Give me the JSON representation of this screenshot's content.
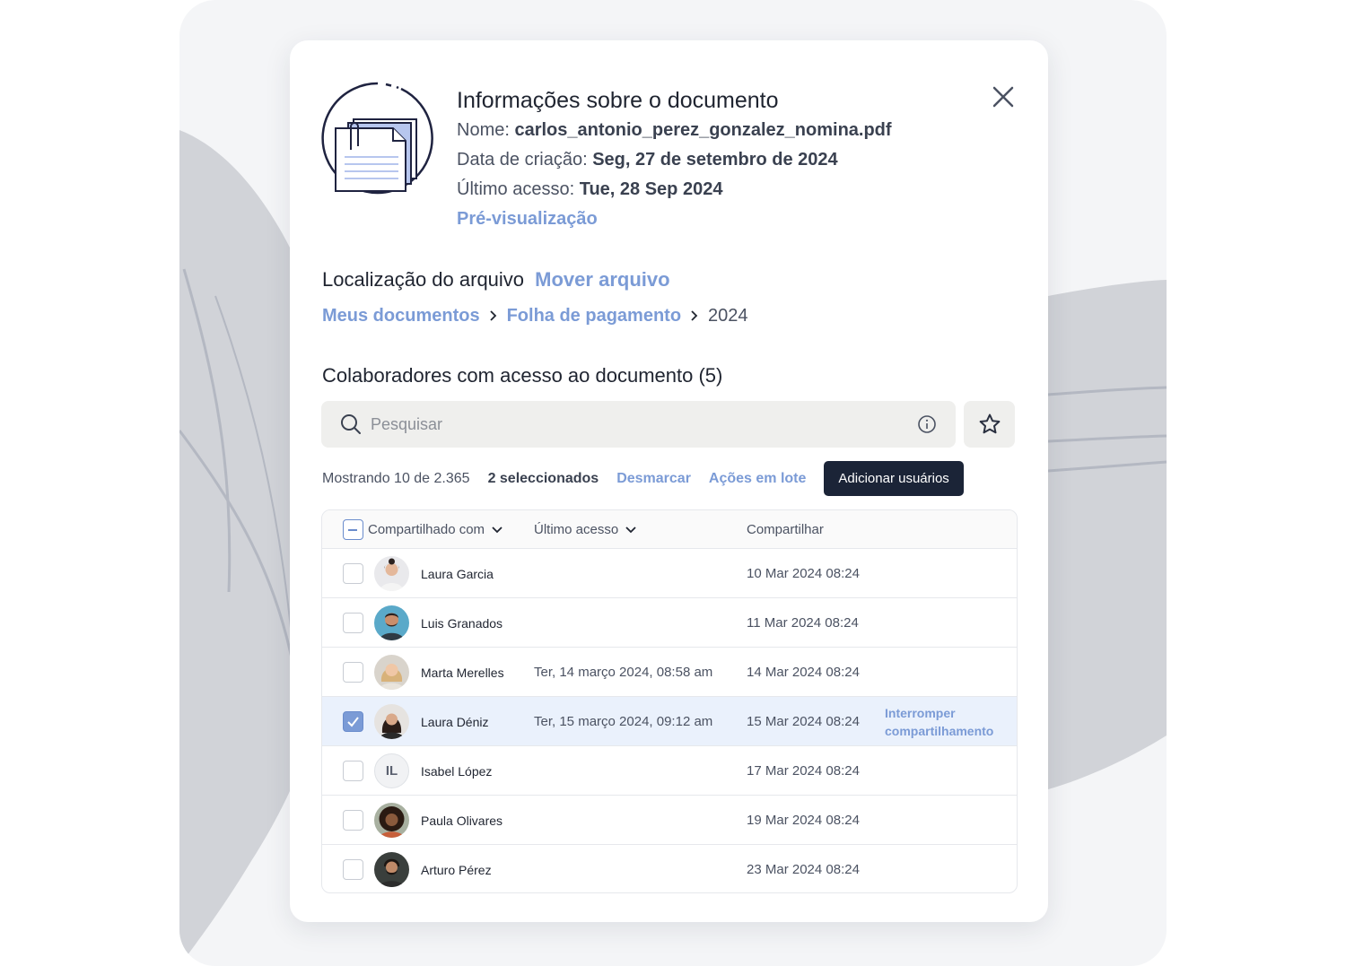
{
  "colors": {
    "accent": "#7b9bd6",
    "primary_button": "#1b2437",
    "selected_row": "#eaf1fc",
    "backdrop": "#f4f5f7"
  },
  "modal": {
    "title": "Informações sobre o documento",
    "name_label": "Nome:",
    "name_value": "carlos_antonio_perez_gonzalez_nomina.pdf",
    "created_label": "Data de criação:",
    "created_value": "Seg, 27 de setembro de 2024",
    "access_label": "Último acesso:",
    "access_value": "Tue, 28 Sep 2024",
    "preview_link": "Pré-visualização",
    "doc_icon": "document-stack-icon",
    "close_icon": "close-icon"
  },
  "location": {
    "title": "Localização do arquivo",
    "move_link": "Mover arquivo",
    "breadcrumb": [
      "Meus documentos",
      "Folha de pagamento",
      "2024"
    ]
  },
  "collaborators": {
    "title": "Colaboradores com acesso ao documento (5)",
    "search_placeholder": "Pesquisar",
    "showing": "Mostrando 10 de 2.365",
    "selected": "2 seleccionados",
    "deselect": "Desmarcar",
    "bulk_actions": "Ações em lote",
    "add_users": "Adicionar usuários",
    "columns": [
      "Compartilhado com",
      "Último acesso",
      "Compartilhar"
    ],
    "rows": [
      {
        "name": "Laura Garcia",
        "last_access": "",
        "shared": "10 Mar 2024 08:24",
        "checked": false
      },
      {
        "name": "Luis Granados",
        "last_access": "",
        "shared": "11 Mar 2024 08:24",
        "checked": false
      },
      {
        "name": "Marta Merelles",
        "last_access": "Ter, 14 março 2024, 08:58 am",
        "shared": "14 Mar 2024 08:24",
        "checked": false
      },
      {
        "name": "Laura Déniz",
        "last_access": "Ter, 15 março 2024, 09:12 am",
        "shared": "15 Mar 2024 08:24",
        "checked": true,
        "action": "Interromper compartilhamento"
      },
      {
        "name": "Isabel López",
        "initials": "IL",
        "last_access": "",
        "shared": "17 Mar 2024 08:24",
        "checked": false
      },
      {
        "name": "Paula Olivares",
        "last_access": "",
        "shared": "19 Mar 2024 08:24",
        "checked": false
      },
      {
        "name": "Arturo Pérez",
        "last_access": "",
        "shared": "23 Mar 2024 08:24",
        "checked": false
      }
    ]
  }
}
